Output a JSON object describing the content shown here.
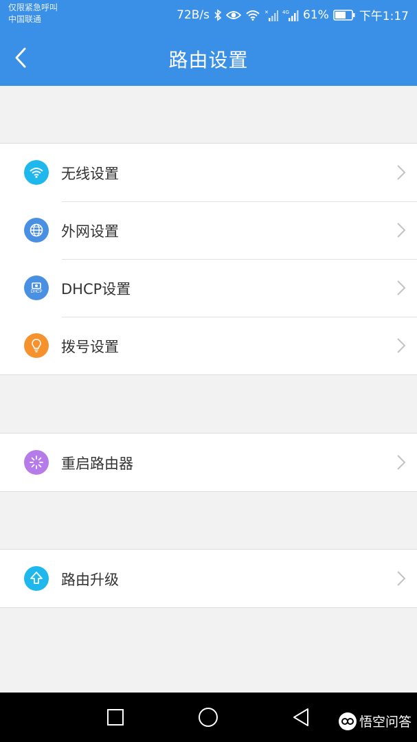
{
  "status_bar": {
    "carrier_line1": "仅限紧急呼叫",
    "carrier_line2": "中国联通",
    "speed": "72B/s",
    "battery": "61%",
    "time": "下午1:17"
  },
  "header": {
    "title": "路由设置"
  },
  "groups": [
    {
      "items": [
        {
          "label": "无线设置",
          "icon": "wifi-icon",
          "color": "#1fb8ec"
        },
        {
          "label": "外网设置",
          "icon": "globe-icon",
          "color": "#4a90e2"
        },
        {
          "label": "DHCP设置",
          "icon": "dhcp-icon",
          "color": "#4a90e2"
        },
        {
          "label": "拨号设置",
          "icon": "bulb-icon",
          "color": "#f5922e"
        }
      ]
    },
    {
      "items": [
        {
          "label": "重启路由器",
          "icon": "restart-icon",
          "color": "#b57be8"
        }
      ]
    },
    {
      "items": [
        {
          "label": "路由升级",
          "icon": "upgrade-icon",
          "color": "#1fb8ec"
        }
      ]
    }
  ],
  "dhcp_icon_text": "DHCP",
  "watermark": {
    "text": "悟空问答"
  },
  "colors": {
    "primary": "#3a8fe6",
    "background": "#f2f2f2"
  }
}
